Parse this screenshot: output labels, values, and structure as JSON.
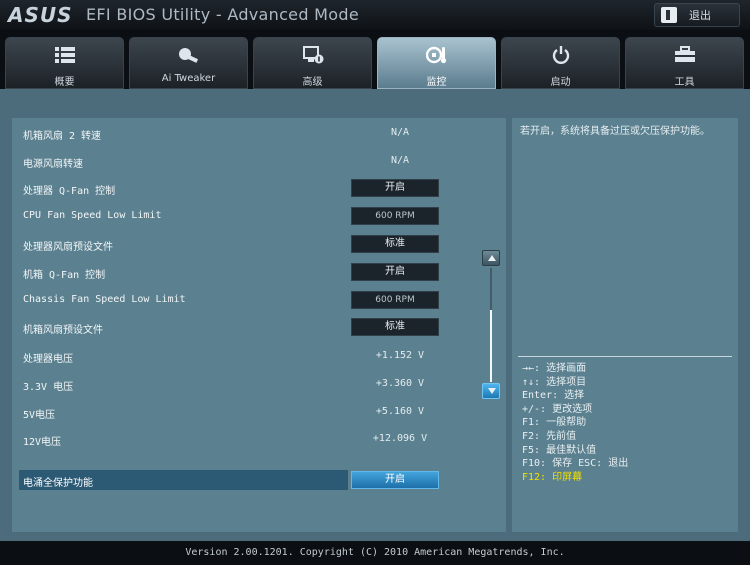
{
  "header": {
    "logo": "ASUS",
    "title": "EFI BIOS Utility - Advanced Mode",
    "exit_label": "退出"
  },
  "tabs": [
    {
      "label": "概要",
      "icon": "list-icon"
    },
    {
      "label": "Ai Tweaker",
      "icon": "tweaker-icon"
    },
    {
      "label": "高级",
      "icon": "advanced-icon"
    },
    {
      "label": "监控",
      "icon": "monitor-icon",
      "active": true
    },
    {
      "label": "启动",
      "icon": "power-icon"
    },
    {
      "label": "工具",
      "icon": "tool-icon"
    }
  ],
  "settings": [
    {
      "label": "机箱风扇 2 转速",
      "value": "N/A"
    },
    {
      "label": "电源风扇转速",
      "value": "N/A"
    },
    {
      "label": "处理器 Q-Fan 控制",
      "value": "开启"
    },
    {
      "label": "CPU Fan Speed Low Limit",
      "value": "600 RPM"
    },
    {
      "label": " 处理器风扇预设文件",
      "value": "标准"
    },
    {
      "label": "机箱 Q-Fan 控制",
      "value": "开启"
    },
    {
      "label": "Chassis Fan Speed Low Limit",
      "value": "600 RPM"
    },
    {
      "label": " 机箱风扇预设文件",
      "value": "标准"
    },
    {
      "label": "处理器电压",
      "value": "+1.152 V"
    },
    {
      "label": "3.3V 电压",
      "value": "+3.360 V"
    },
    {
      "label": "5V电压",
      "value": "+5.160 V"
    },
    {
      "label": "12V电压",
      "value": "+12.096 V"
    },
    {
      "label": "电涌全保护功能",
      "value": "开启"
    }
  ],
  "help": {
    "description": "若开启，系统将具备过压或欠压保护功能。"
  },
  "keys": [
    "→←: 选择画面",
    "↑↓: 选择项目",
    "Enter: 选择",
    "+/-: 更改选项",
    "F1: 一般帮助",
    "F2: 先前值",
    "F5: 最佳默认值",
    "F10: 保存  ESC: 退出",
    "F12: 印屏幕"
  ],
  "footer": {
    "version": "Version 2.00.1201. Copyright (C) 2010 American Megatrends, Inc."
  },
  "colors": {
    "panel": "#5b808f",
    "highlight": "#2c5a74",
    "accent_key": "#f0e100",
    "selected_button": "#2f8fcf"
  }
}
